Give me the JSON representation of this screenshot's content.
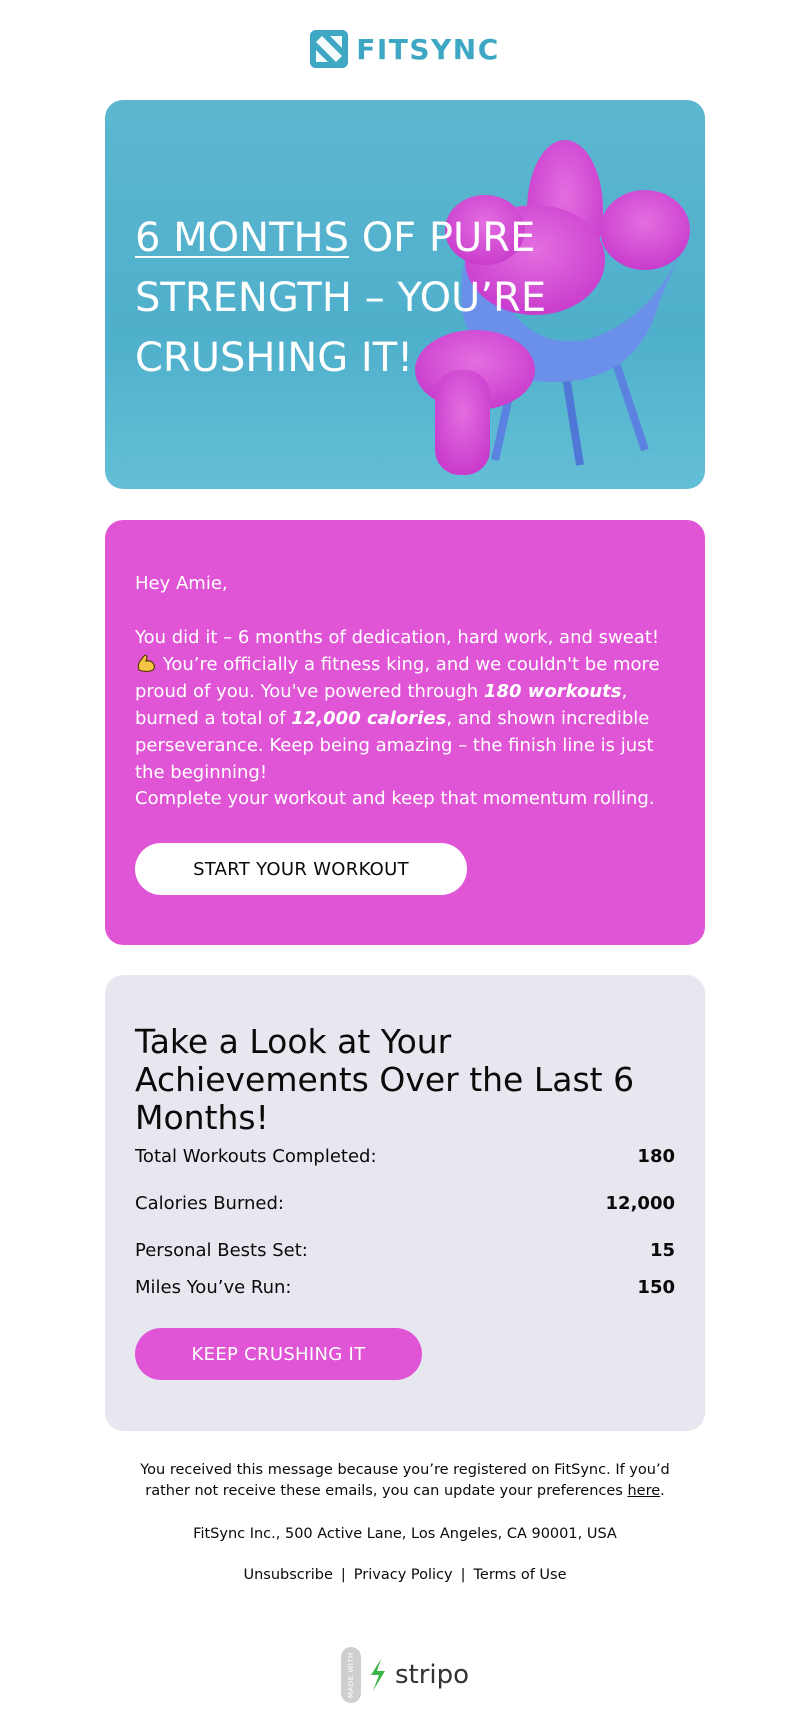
{
  "brand": {
    "name": "FITSYNC",
    "accent": "#3ea7c4",
    "pink": "#df55d6"
  },
  "hero": {
    "title_underlined": "6 MONTHS",
    "title_rest": " OF PURE STRENGTH – YOU’RE CRUSHING IT!",
    "image": "pink-furry-creature-in-blue-chair"
  },
  "message": {
    "greeting": "Hey Amie,",
    "p1_a": "You did it – 6 months of dedication, hard work, and sweat! ",
    "p1_emoji": "flexed-biceps-icon",
    "p1_b": " You’re officially a fitness king, and we couldn't be more proud of you. You've powered through ",
    "workouts": "180 workouts",
    "p1_c": ", burned a total of ",
    "calories": "12,000 calories",
    "p1_d": ", and shown incredible perseverance. Keep being amazing – the finish line is just the beginning!",
    "cta_text": "Complete your workout and keep that momentum rolling.",
    "button": "START YOUR WORKOUT"
  },
  "achievements": {
    "title": "Take a Look at Your Achievements Over the Last 6 Months!",
    "stats": [
      {
        "label": "Total Workouts Completed:",
        "value": "180"
      },
      {
        "label": "Calories Burned:",
        "value": "12,000"
      },
      {
        "label": "Personal Bests Set:",
        "value": "15"
      },
      {
        "label": "Miles You’ve Run:",
        "value": "150"
      }
    ],
    "button": "KEEP CRUSHING IT"
  },
  "footer": {
    "notice_a": "You received this message because you’re registered on FitSync. If you’d rather not receive these emails, you can update your preferences ",
    "notice_link": "here",
    "notice_b": ".",
    "address": "FitSync Inc., 500 Active Lane, Los Angeles, CA 90001, USA",
    "links": [
      "Unsubscribe",
      "Privacy Policy",
      "Terms of Use"
    ],
    "separator": "|"
  },
  "badge": {
    "made_with": "MADE WITH",
    "name": "stripo"
  }
}
